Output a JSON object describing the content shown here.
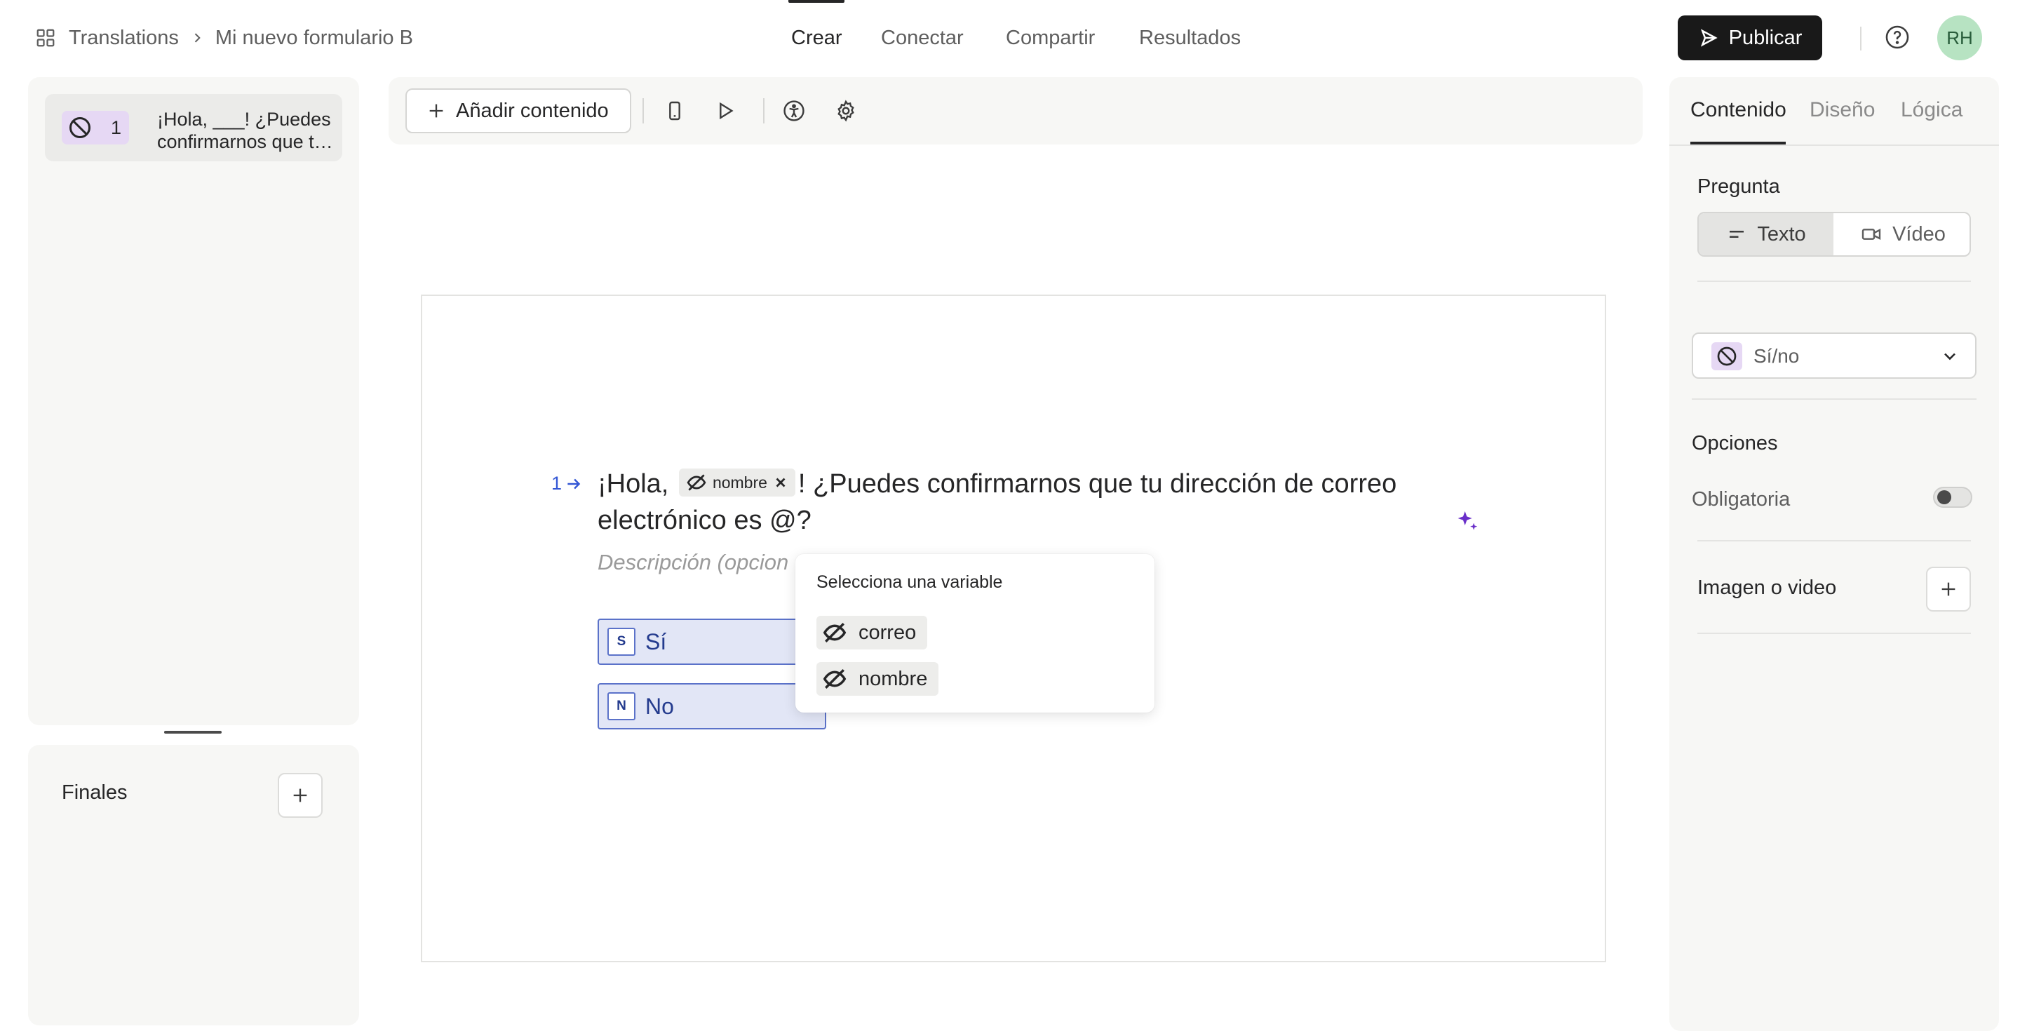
{
  "header": {
    "breadcrumb_root": "Translations",
    "breadcrumb_current": "Mi nuevo formulario B",
    "tabs": [
      {
        "label": "Crear",
        "active": true
      },
      {
        "label": "Conectar",
        "active": false
      },
      {
        "label": "Compartir",
        "active": false
      },
      {
        "label": "Resultados",
        "active": false
      }
    ],
    "publish_label": "Publicar",
    "avatar_initials": "RH"
  },
  "sidebar": {
    "questions": [
      {
        "number": "1",
        "text": "¡Hola, ___! ¿Puedes confirmarnos que t…",
        "icon": "no-symbol-icon"
      }
    ],
    "endings_label": "Finales"
  },
  "toolbar": {
    "add_content_label": "Añadir contenido"
  },
  "question": {
    "number": "1",
    "title_before": "¡Hola,",
    "variable_chip": "nombre",
    "title_after": "! ¿Puedes confirmarnos que tu dirección de correo electrónico es @?",
    "description_placeholder": "Descripción (opcion",
    "choices": [
      {
        "key": "S",
        "label": "Sí"
      },
      {
        "key": "N",
        "label": "No"
      }
    ]
  },
  "variable_popup": {
    "title": "Selecciona una variable",
    "options": [
      "correo",
      "nombre"
    ]
  },
  "right_panel": {
    "tabs": [
      {
        "label": "Contenido",
        "active": true
      },
      {
        "label": "Diseño",
        "active": false
      },
      {
        "label": "Lógica",
        "active": false
      }
    ],
    "question_label": "Pregunta",
    "media_options": [
      {
        "label": "Texto",
        "active": true
      },
      {
        "label": "Vídeo",
        "active": false
      }
    ],
    "question_type": "Sí/no",
    "options_label": "Opciones",
    "required_label": "Obligatoria",
    "required_on": false,
    "image_video_label": "Imagen o video"
  },
  "colors": {
    "accent_blue": "#3457d5",
    "choice_fill": "#e2e6f6",
    "avatar_green": "#b7e3c2",
    "badge_purple": "#e6d8f4"
  }
}
